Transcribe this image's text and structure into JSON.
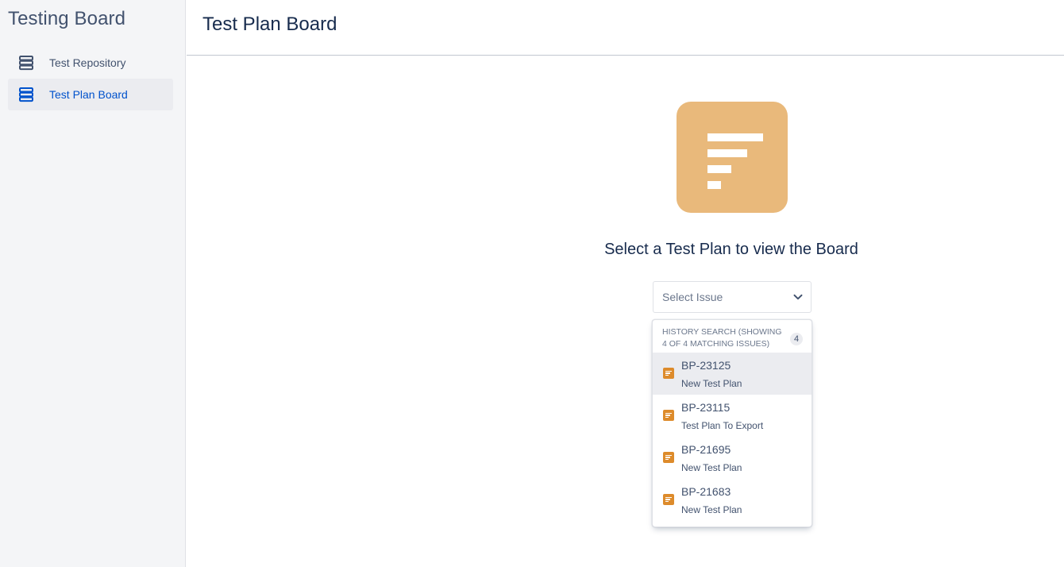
{
  "sidebar": {
    "title": "Testing Board",
    "items": [
      {
        "label": "Test Repository",
        "icon": "stack-icon",
        "active": false
      },
      {
        "label": "Test Plan Board",
        "icon": "stack-icon",
        "active": true
      }
    ]
  },
  "header": {
    "title": "Test Plan Board"
  },
  "main": {
    "illustration_icon": "test-plan-icon",
    "message": "Select a Test Plan to view the Board",
    "select": {
      "placeholder": "Select Issue"
    },
    "dropdown": {
      "header": "HISTORY SEARCH (SHOWING 4 OF 4 MATCHING ISSUES)",
      "count": "4",
      "options": [
        {
          "key": "BP-23125",
          "summary": "New Test Plan",
          "highlighted": true
        },
        {
          "key": "BP-23115",
          "summary": "Test Plan To Export",
          "highlighted": false
        },
        {
          "key": "BP-21695",
          "summary": "New Test Plan",
          "highlighted": false
        },
        {
          "key": "BP-21683",
          "summary": "New Test Plan",
          "highlighted": false
        }
      ]
    }
  },
  "colors": {
    "accent": "#0052cc",
    "sidebar_bg": "#f4f5f7",
    "illustration": "#e9b97b",
    "issue_icon": "#dd8b2b",
    "text": "#172b4d"
  }
}
